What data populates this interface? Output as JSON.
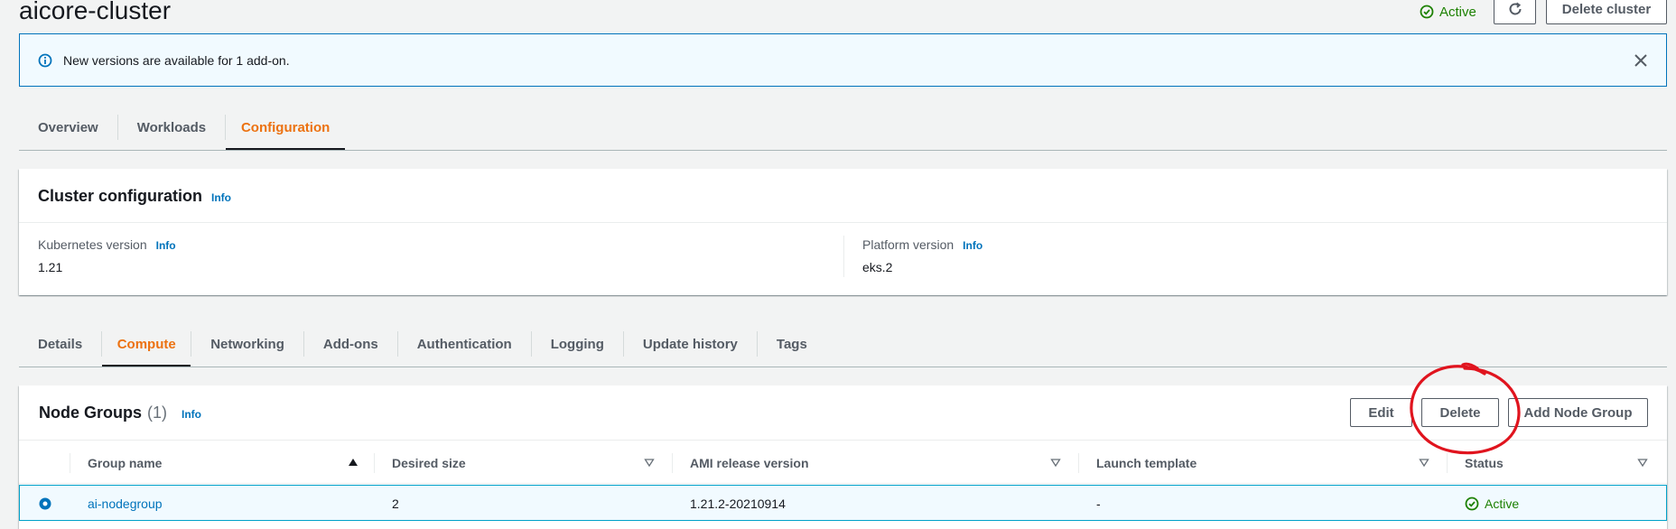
{
  "header": {
    "title": "aicore-cluster",
    "status": "Active",
    "delete_cluster_label": "Delete cluster"
  },
  "flash": {
    "message": "New versions are available for 1 add-on."
  },
  "main_tabs": [
    {
      "label": "Overview"
    },
    {
      "label": "Workloads"
    },
    {
      "label": "Configuration"
    }
  ],
  "cluster_config": {
    "title": "Cluster configuration",
    "info": "Info",
    "kubernetes_label": "Kubernetes version",
    "kubernetes_info": "Info",
    "kubernetes_value": "1.21",
    "platform_label": "Platform version",
    "platform_info": "Info",
    "platform_value": "eks.2"
  },
  "sub_tabs": [
    {
      "label": "Details"
    },
    {
      "label": "Compute"
    },
    {
      "label": "Networking"
    },
    {
      "label": "Add-ons"
    },
    {
      "label": "Authentication"
    },
    {
      "label": "Logging"
    },
    {
      "label": "Update history"
    },
    {
      "label": "Tags"
    }
  ],
  "node_groups": {
    "title": "Node Groups",
    "count": "(1)",
    "info": "Info",
    "edit_label": "Edit",
    "delete_label": "Delete",
    "add_label": "Add Node Group",
    "columns": [
      "Group name",
      "Desired size",
      "AMI release version",
      "Launch template",
      "Status"
    ],
    "rows": [
      {
        "name": "ai-nodegroup",
        "desired": "2",
        "ami": "1.21.2-20210914",
        "template": "-",
        "status": "Active"
      }
    ]
  },
  "colors": {
    "accent_orange": "#ec7211",
    "link_blue": "#0073bb",
    "success_green": "#1d8102",
    "annotation_red": "#e0141e"
  }
}
